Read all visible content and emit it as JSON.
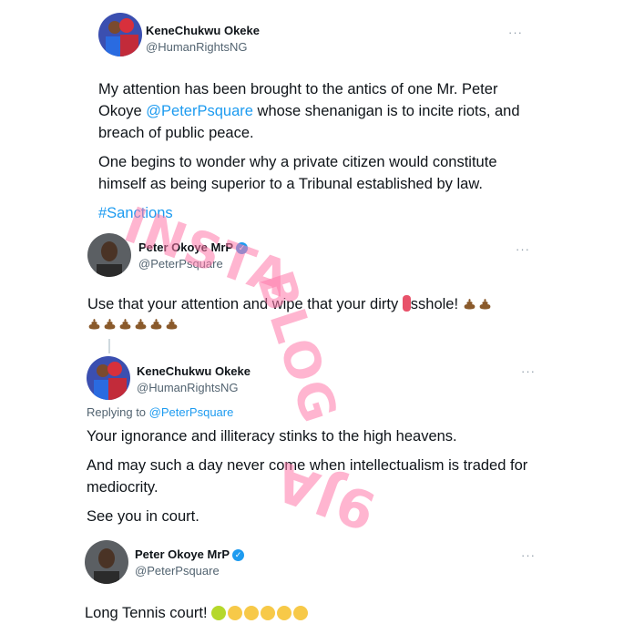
{
  "tweets": [
    {
      "name": "KeneChukwu Okeke",
      "handle": "@HumanRightsNG",
      "paragraphs": [
        {
          "before": "My attention has been brought to the antics of one Mr. Peter Okoye ",
          "mention": "@PeterPsquare",
          "after": " whose shenanigan is to incite riots, and breach of public peace."
        },
        {
          "text": "One begins to wonder why a private citizen would constitute himself as being superior to a Tribunal established by law."
        }
      ],
      "hashtag": "#Sanctions"
    },
    {
      "name": "Peter Okoye MrP",
      "handle": "@PeterPsquare",
      "text_before": "Use that your attention and wipe that your dirty ",
      "text_after": "sshole!",
      "emoji_desc": "pile-of-poo x8"
    },
    {
      "name": "KeneChukwu Okeke",
      "handle": "@HumanRightsNG",
      "replying_prefix": "Replying to ",
      "replying_to": "@PeterPsquare",
      "paragraphs": [
        "Your ignorance and illiteracy stinks to the high heavens.",
        "And may such a day never come when intellectualism is traded for mediocrity.",
        "See you in court."
      ]
    },
    {
      "name": "Peter Okoye MrP",
      "handle": "@PeterPsquare",
      "text": "Long Tennis court!",
      "emoji_desc": "tennis-ball, laughing faces"
    }
  ],
  "more_label": "···",
  "verified_glyph": "✓",
  "watermark": {
    "line1": "INSTA",
    "line2": "BLOG",
    "line3": "9JA"
  },
  "colors": {
    "link": "#1d9bf0",
    "watermark": "#ff78aa",
    "verified": "#1d9bf0"
  }
}
